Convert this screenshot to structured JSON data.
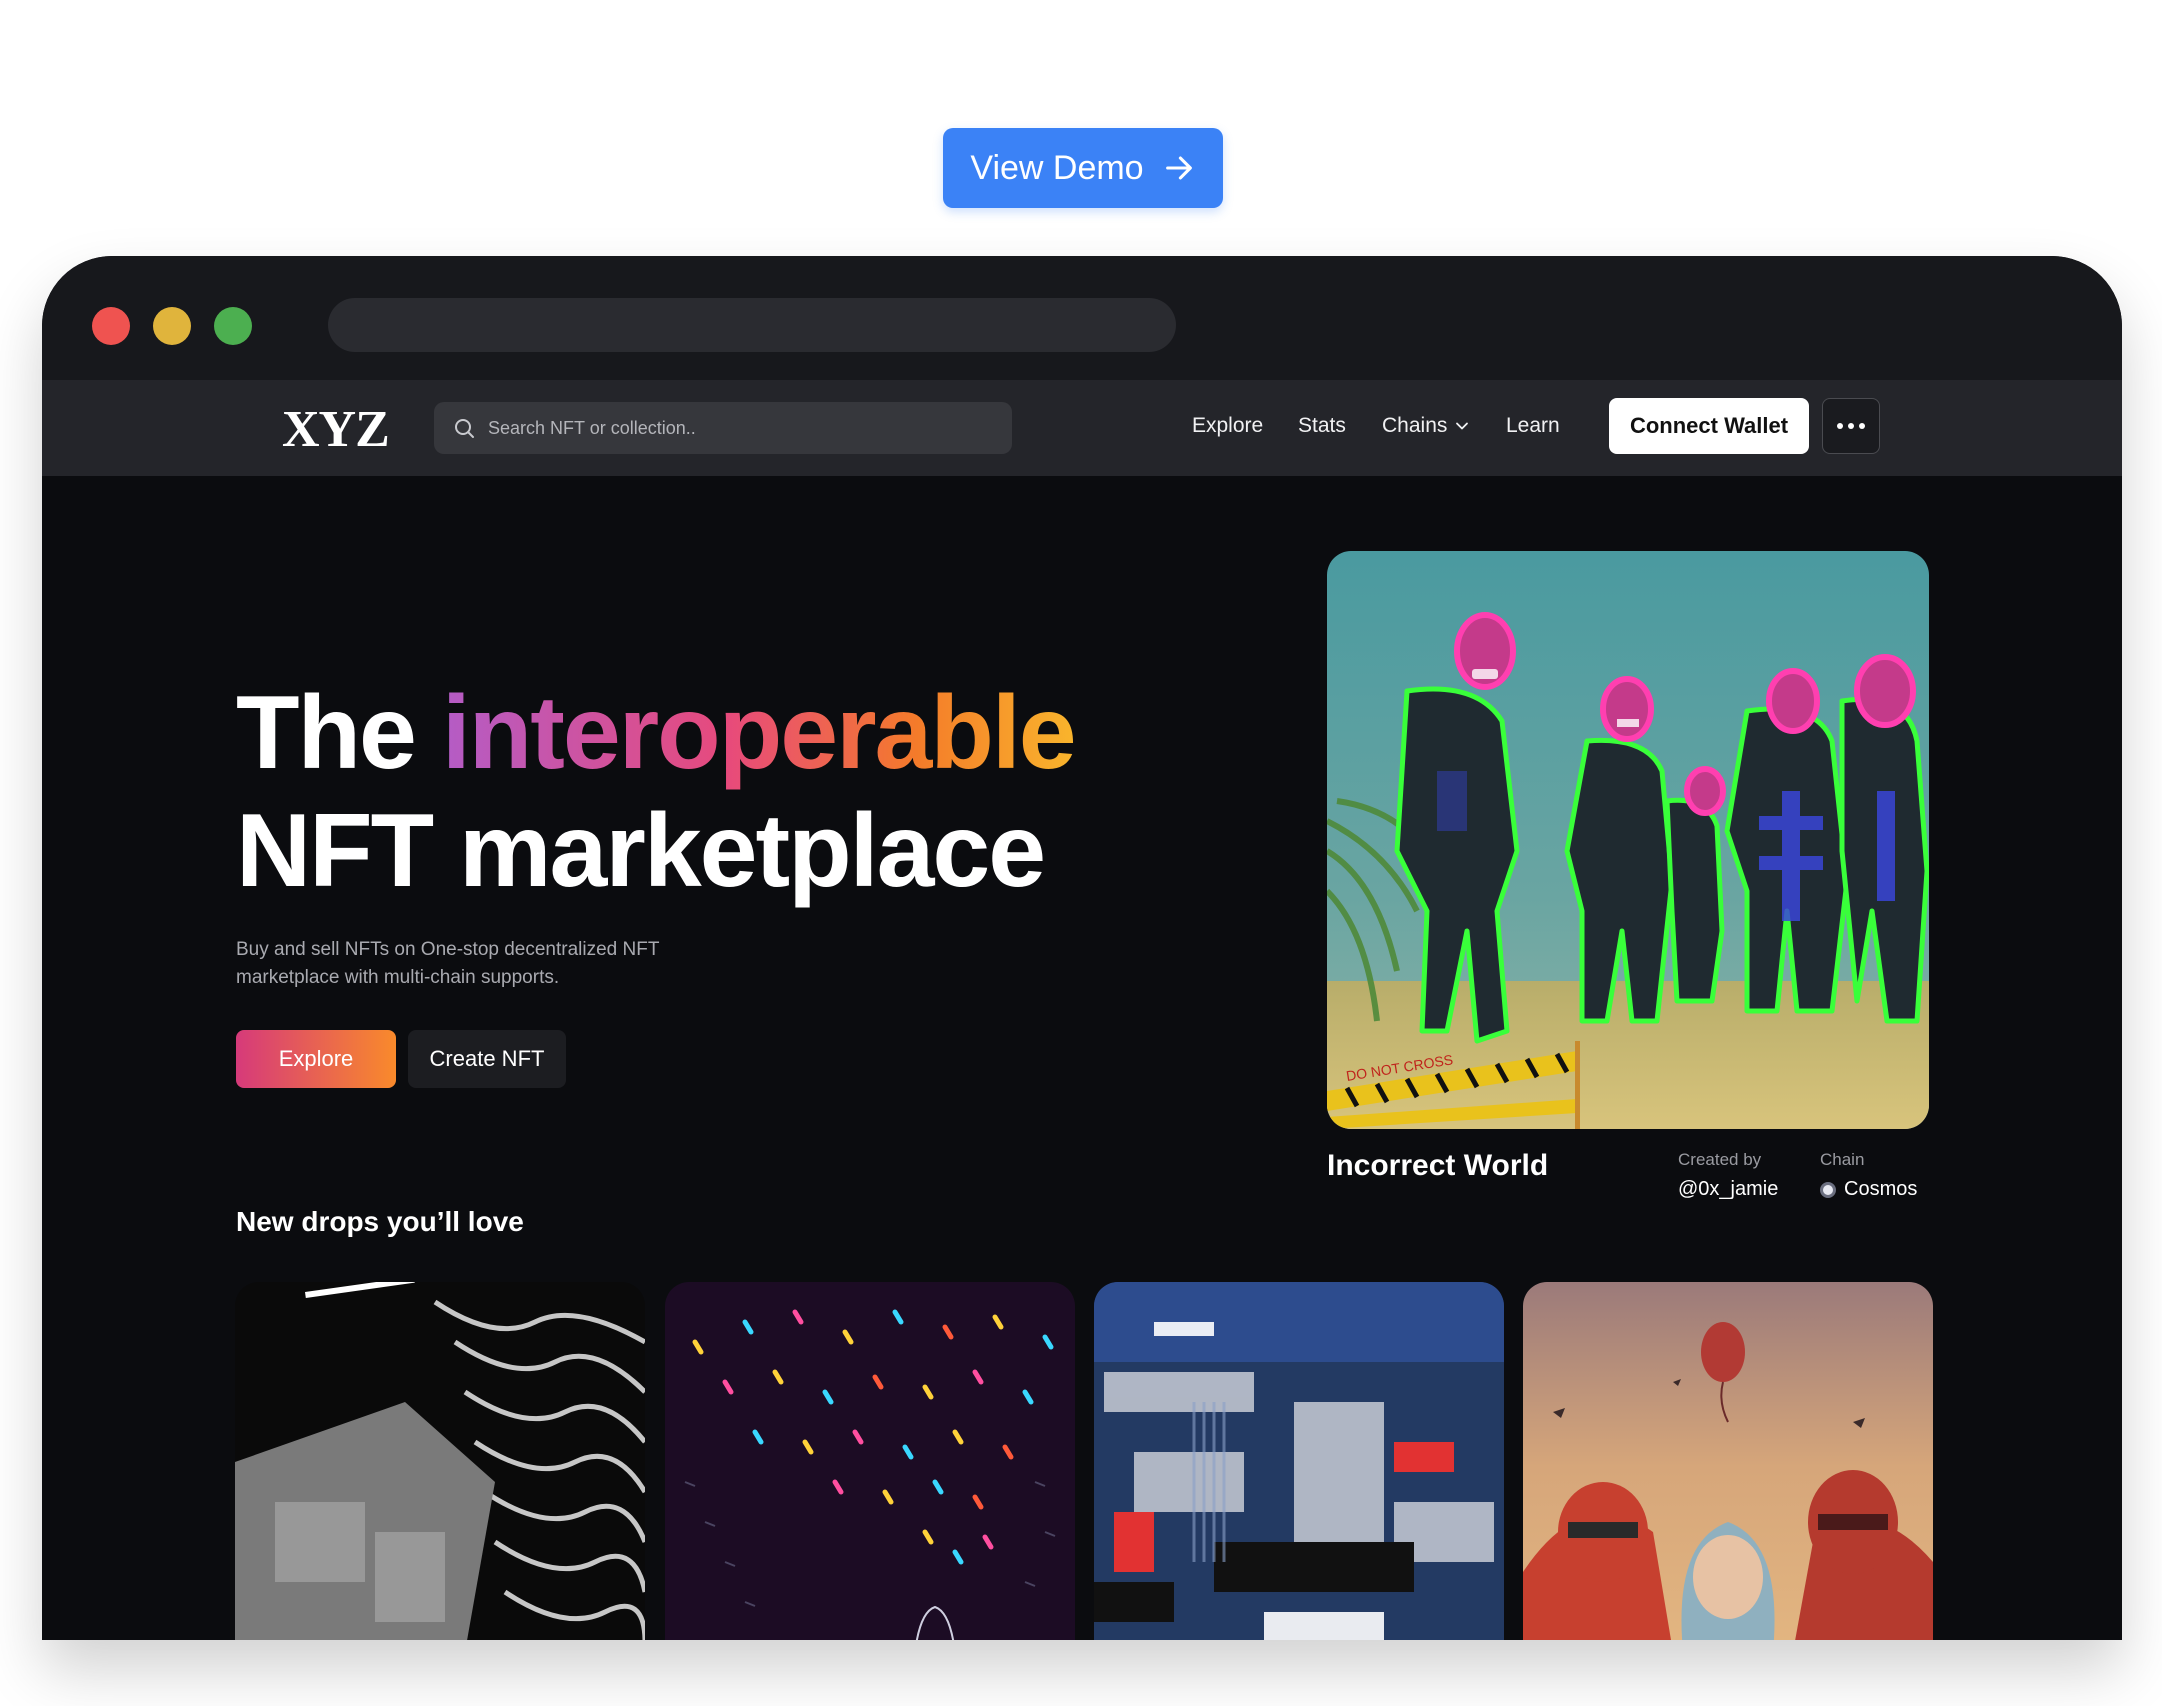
{
  "demo_button": {
    "label": "View Demo",
    "icon": "arrow-right-icon"
  },
  "browser": {
    "window_controls": [
      "close",
      "minimize",
      "maximize"
    ]
  },
  "nav": {
    "logo": "XYZ",
    "search_placeholder": "Search NFT or collection..",
    "links": [
      "Explore",
      "Stats",
      "Chains",
      "Learn"
    ],
    "connect_wallet": "Connect Wallet",
    "more_icon": "more-horizontal-icon"
  },
  "hero": {
    "title_line1_prefix": "The",
    "title_line1_highlight": "interoperable",
    "title_line2": "NFT marketplace",
    "subtitle": "Buy and sell NFTs on One-stop decentralized NFT marketplace with multi-chain supports.",
    "explore_button": "Explore",
    "create_button": "Create NFT"
  },
  "featured": {
    "name": "Incorrect World",
    "created_by_label": "Created by",
    "creator": "@0x_jamie",
    "chain_label": "Chain",
    "chain": "Cosmos",
    "caution_tape_text": "DO NOT CROSS"
  },
  "drops": {
    "title": "New drops you’ll love"
  },
  "colors": {
    "demo_blue": "#3b82f6",
    "page_bg": "#0b0c0f",
    "nav_bg": "#24252a",
    "gradient": [
      "#b45cc6",
      "#e74a7c",
      "#f47b2a",
      "#f9b52c"
    ]
  }
}
